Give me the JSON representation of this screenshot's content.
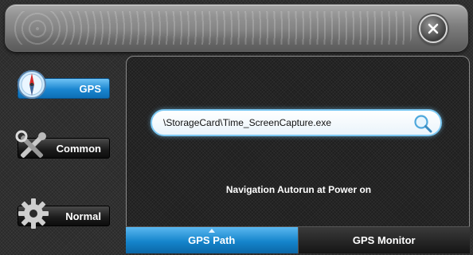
{
  "titlebar": {
    "close_icon": "close-x-icon"
  },
  "sidebar": {
    "items": [
      {
        "label": "GPS",
        "icon": "compass-icon",
        "active": true
      },
      {
        "label": "Common",
        "icon": "tools-icon",
        "active": false
      },
      {
        "label": "Normal",
        "icon": "gear-icon",
        "active": false
      }
    ]
  },
  "main": {
    "path_value": "\\StorageCard\\Time_ScreenCapture.exe",
    "search_icon": "magnifier-icon",
    "autorun_label": "Navigation Autorun at Power on"
  },
  "tabs": [
    {
      "label": "GPS Path",
      "active": true
    },
    {
      "label": "GPS Monitor",
      "active": false
    }
  ],
  "colors": {
    "accent": "#1a86d0",
    "input_border": "#7cc8f2"
  }
}
